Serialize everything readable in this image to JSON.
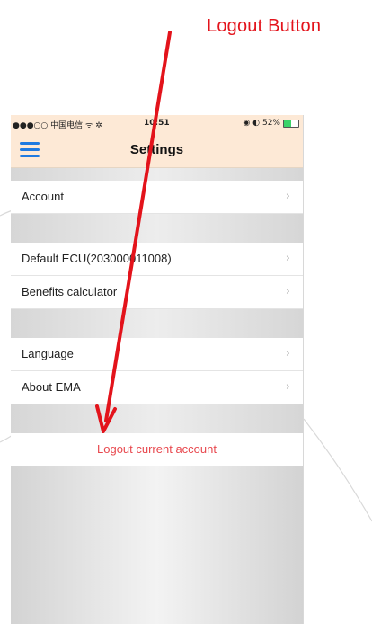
{
  "annotation": {
    "label": "Logout Button",
    "color": "#e3131b"
  },
  "status_bar": {
    "carrier": "●●●○○ 中国电信 ᯤ ✲",
    "time": "10:51",
    "right_icons": "◉ ◐",
    "battery_percent": "52%",
    "battery_level": 0.52
  },
  "nav": {
    "menu_icon": "hamburger-menu-icon",
    "title": "Settings"
  },
  "sections": {
    "account": {
      "label": "Account"
    },
    "default_ecu": {
      "label": "Default ECU(203000011008)"
    },
    "benefits": {
      "label": "Benefits calculator"
    },
    "language": {
      "label": "Language"
    },
    "about": {
      "label": "About EMA"
    }
  },
  "chevron": "›",
  "logout": {
    "label": "Logout current account",
    "color": "#e8484e"
  }
}
